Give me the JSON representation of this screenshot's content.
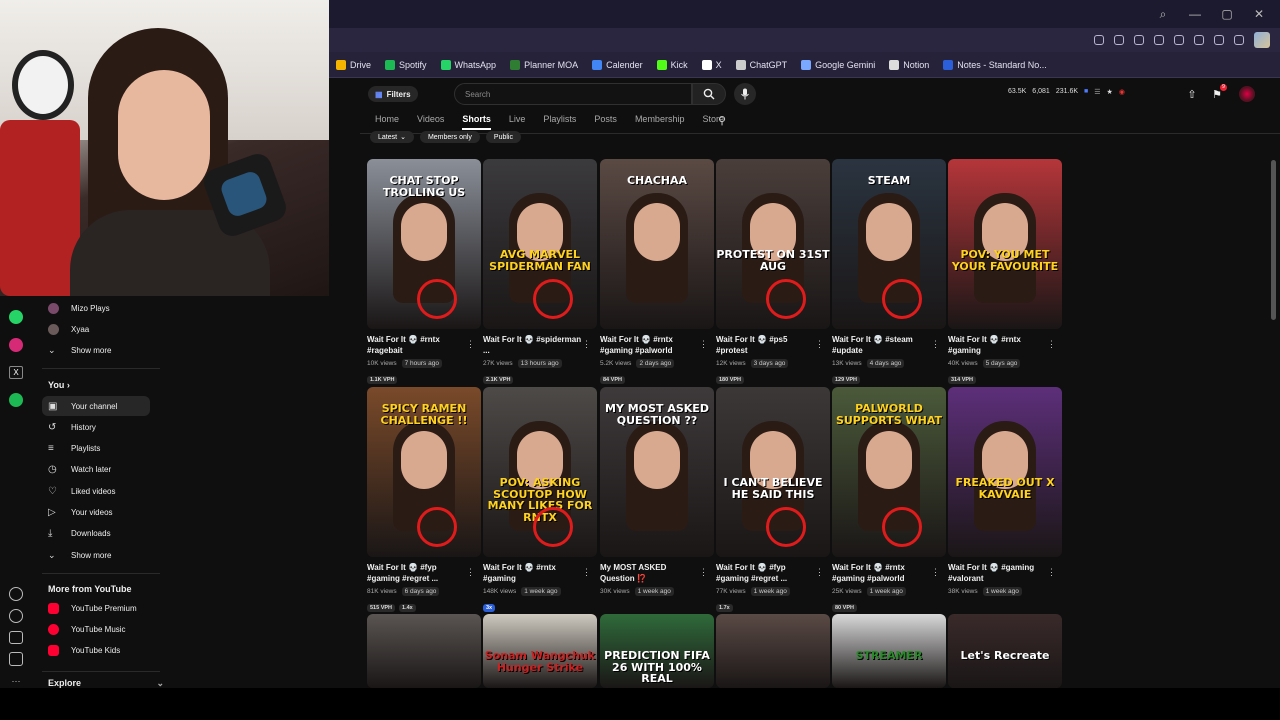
{
  "window": {
    "controls": [
      "⌕",
      "—",
      "▢",
      "✕"
    ]
  },
  "bookmarks": [
    {
      "label": "Drive",
      "color": "#f4b400"
    },
    {
      "label": "Spotify",
      "color": "#1db954"
    },
    {
      "label": "WhatsApp",
      "color": "#25d366"
    },
    {
      "label": "Planner MOA",
      "color": "#2e7d32"
    },
    {
      "label": "Calender",
      "color": "#4285f4"
    },
    {
      "label": "Kick",
      "color": "#53fc18"
    },
    {
      "label": "X",
      "color": "#ffffff"
    },
    {
      "label": "ChatGPT",
      "color": "#cccccc"
    },
    {
      "label": "Google Gemini",
      "color": "#7aa7ff"
    },
    {
      "label": "Notion",
      "color": "#dddddd"
    },
    {
      "label": "Notes - Standard No...",
      "color": "#2b5fd9"
    }
  ],
  "header": {
    "filters": "Filters",
    "search_placeholder": "Search",
    "stats": [
      "63.5K",
      "6,081",
      "231.6K"
    ],
    "notif_count": "9"
  },
  "tabs": [
    "Home",
    "Videos",
    "Shorts",
    "Live",
    "Playlists",
    "Posts",
    "Membership",
    "Store"
  ],
  "active_tab": "Shorts",
  "chips": [
    "Latest",
    "Members only",
    "Public"
  ],
  "sidebar": {
    "subs": [
      {
        "label": "Mizo Plays"
      },
      {
        "label": "Xyaa"
      }
    ],
    "subs_more": "Show more",
    "you_heading": "You",
    "you_items": [
      "Your channel",
      "History",
      "Playlists",
      "Watch later",
      "Liked videos",
      "Your videos",
      "Downloads"
    ],
    "you_more": "Show more",
    "more_heading": "More from YouTube",
    "more_items": [
      "YouTube Premium",
      "YouTube Music",
      "YouTube Kids"
    ],
    "explore": "Explore"
  },
  "shorts": [
    {
      "title": "Wait For It 💀 #rntx #ragebait",
      "views": "10K views",
      "age": "7 hours ago",
      "vph": "1.1K VPH",
      "overlay": "CHAT STOP TROLLING US",
      "bg": "#8a8f98",
      "oc": "#ffffff"
    },
    {
      "title": "Wait For It 💀 #spiderman ...",
      "views": "27K views",
      "age": "13 hours ago",
      "vph": "2.1K VPH",
      "overlay": "AVG MARVEL SPIDERMAN FAN",
      "bg": "#3b3a3d",
      "oc": "#ffd21f"
    },
    {
      "title": "Wait For It 💀 #rntx #gaming #palworld",
      "views": "5.2K views",
      "age": "2 days ago",
      "vph": "84 VPH",
      "overlay": "CHACHAA",
      "bg": "#5b4a44",
      "oc": "#ffffff"
    },
    {
      "title": "Wait For It 💀 #ps5 #protest",
      "views": "12K views",
      "age": "3 days ago",
      "vph": "180 VPH",
      "overlay": "PROTEST ON 31ST AUG",
      "bg": "#4a3e3a",
      "oc": "#ffffff"
    },
    {
      "title": "Wait For It 💀 #steam #update",
      "views": "13K views",
      "age": "4 days ago",
      "vph": "129 VPH",
      "overlay": "STEAM",
      "bg": "#2a3440",
      "oc": "#ffffff"
    },
    {
      "title": "Wait For It 💀 #rntx #gaming",
      "views": "40K views",
      "age": "5 days ago",
      "vph": "314 VPH",
      "overlay": "POV: YOU MET YOUR FAVOURITE",
      "bg": "#b5363a",
      "oc": "#ffd21f"
    },
    {
      "title": "Wait For It 💀 #fyp #gaming #regret ...",
      "views": "81K views",
      "age": "6 days ago",
      "vph": "515 VPH",
      "vph2": "1.4x",
      "overlay": "SPICY RAMEN CHALLENGE !!",
      "bg": "#7a4a2a",
      "oc": "#ffd21f"
    },
    {
      "title": "Wait For It 💀 #rntx #gaming",
      "views": "148K views",
      "age": "1 week ago",
      "vph": "3x",
      "vph_blue": true,
      "overlay": "POV: ASKING SCOUTOP HOW MANY LIKES FOR RNTX",
      "bg": "#4d4a48",
      "oc": "#ffd21f"
    },
    {
      "title": "My MOST ASKED Question ⁉️",
      "views": "30K views",
      "age": "1 week ago",
      "vph": "",
      "overlay": "MY MOST ASKED QUESTION ??",
      "bg": "#3e3a3b",
      "oc": "#ffffff"
    },
    {
      "title": "Wait For It 💀 #fyp #gaming #regret ...",
      "views": "77K views",
      "age": "1 week ago",
      "vph": "1.7x",
      "overlay": "I CAN'T BELIEVE HE SAID THIS",
      "bg": "#3c3837",
      "oc": "#ffffff"
    },
    {
      "title": "Wait For It 💀 #rntx #gaming #palworld",
      "views": "25K views",
      "age": "1 week ago",
      "vph": "80 VPH",
      "overlay": "PALWORLD SUPPORTS WHAT",
      "bg": "#4b5a3a",
      "oc": "#ffd21f"
    },
    {
      "title": "Wait For It 💀 #gaming #valorant",
      "views": "38K views",
      "age": "1 week ago",
      "vph": "",
      "overlay": "FREAKED OUT X KAVVAIE",
      "bg": "#5d2f7a",
      "oc": "#ffd21f"
    },
    {
      "title": "",
      "views": "",
      "age": "",
      "vph": "",
      "overlay": "",
      "bg": "#5a5552",
      "oc": "#ffffff"
    },
    {
      "title": "",
      "views": "",
      "age": "",
      "vph": "",
      "overlay": "Sonam Wangchuk Hunger Strike",
      "bg": "#cfcac0",
      "oc": "#c22"
    },
    {
      "title": "",
      "views": "",
      "age": "",
      "vph": "",
      "overlay": "PREDICTION FIFA 26 WITH 100% REAL",
      "bg": "#2f6a3a",
      "oc": "#ffffff"
    },
    {
      "title": "",
      "views": "",
      "age": "",
      "vph": "",
      "overlay": "",
      "bg": "#5a4a45",
      "oc": "#ffffff"
    },
    {
      "title": "",
      "views": "",
      "age": "",
      "vph": "",
      "overlay": "STREAMER",
      "bg": "#d9d9d9",
      "oc": "#2a8a2a"
    },
    {
      "title": "",
      "views": "",
      "age": "",
      "vph": "",
      "overlay": "Let's Recreate",
      "bg": "#3a2a2a",
      "oc": "#ffffff"
    }
  ]
}
